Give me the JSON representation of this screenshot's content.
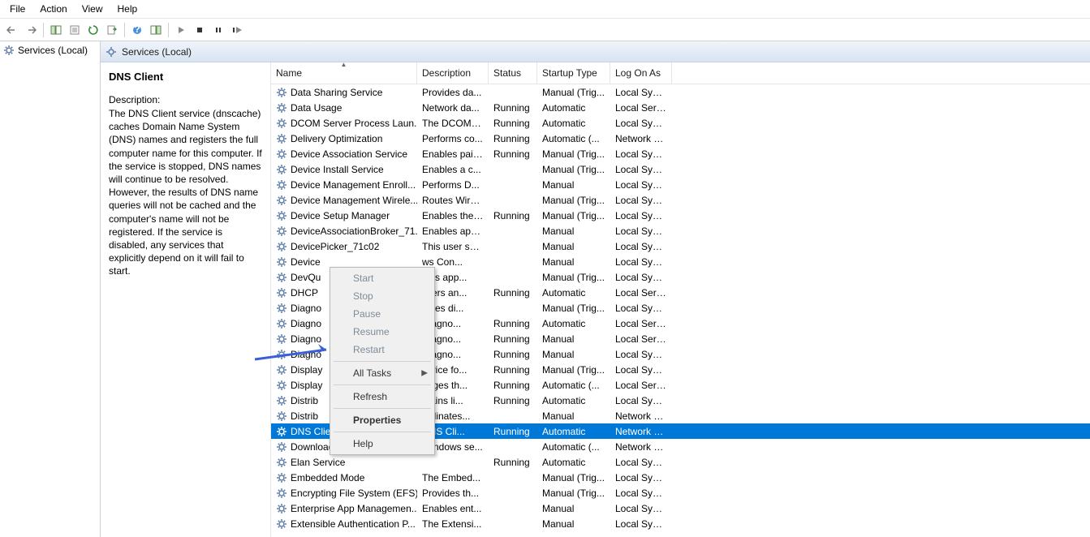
{
  "menu": {
    "items": [
      "File",
      "Action",
      "View",
      "Help"
    ]
  },
  "tree": {
    "root": "Services (Local)"
  },
  "tab": {
    "title": "Services (Local)"
  },
  "detail": {
    "title": "DNS Client",
    "subhead": "Description:",
    "description": "The DNS Client service (dnscache) caches Domain Name System (DNS) names and registers the full computer name for this computer. If the service is stopped, DNS names will continue to be resolved. However, the results of DNS name queries will not be cached and the computer's name will not be registered. If the service is disabled, any services that explicitly depend on it will fail to start."
  },
  "columns": [
    "Name",
    "Description",
    "Status",
    "Startup Type",
    "Log On As"
  ],
  "rows": [
    {
      "name": "Data Sharing Service",
      "desc": "Provides da...",
      "status": "",
      "startup": "Manual (Trig...",
      "logon": "Local Syste..."
    },
    {
      "name": "Data Usage",
      "desc": "Network da...",
      "status": "Running",
      "startup": "Automatic",
      "logon": "Local Service"
    },
    {
      "name": "DCOM Server Process Laun...",
      "desc": "The DCOML...",
      "status": "Running",
      "startup": "Automatic",
      "logon": "Local Syste..."
    },
    {
      "name": "Delivery Optimization",
      "desc": "Performs co...",
      "status": "Running",
      "startup": "Automatic (...",
      "logon": "Network S..."
    },
    {
      "name": "Device Association Service",
      "desc": "Enables pair...",
      "status": "Running",
      "startup": "Manual (Trig...",
      "logon": "Local Syste..."
    },
    {
      "name": "Device Install Service",
      "desc": "Enables a c...",
      "status": "",
      "startup": "Manual (Trig...",
      "logon": "Local Syste..."
    },
    {
      "name": "Device Management Enroll...",
      "desc": "Performs D...",
      "status": "",
      "startup": "Manual",
      "logon": "Local Syste..."
    },
    {
      "name": "Device Management Wirele...",
      "desc": "Routes Wire...",
      "status": "",
      "startup": "Manual (Trig...",
      "logon": "Local Syste..."
    },
    {
      "name": "Device Setup Manager",
      "desc": "Enables the ...",
      "status": "Running",
      "startup": "Manual (Trig...",
      "logon": "Local Syste..."
    },
    {
      "name": "DeviceAssociationBroker_71...",
      "desc": "Enables app...",
      "status": "",
      "startup": "Manual",
      "logon": "Local Syste..."
    },
    {
      "name": "DevicePicker_71c02",
      "desc": "This user ser...",
      "status": "",
      "startup": "Manual",
      "logon": "Local Syste..."
    },
    {
      "name": "Device",
      "desc": "ws Con...",
      "status": "",
      "startup": "Manual",
      "logon": "Local Syste..."
    },
    {
      "name": "DevQu",
      "desc": "bles app...",
      "status": "",
      "startup": "Manual (Trig...",
      "logon": "Local Syste..."
    },
    {
      "name": "DHCP",
      "desc": "isters an...",
      "status": "Running",
      "startup": "Automatic",
      "logon": "Local Service"
    },
    {
      "name": "Diagno",
      "desc": "cutes di...",
      "status": "",
      "startup": "Manual (Trig...",
      "logon": "Local Syste..."
    },
    {
      "name": "Diagno",
      "desc": "Diagno...",
      "status": "Running",
      "startup": "Automatic",
      "logon": "Local Service"
    },
    {
      "name": "Diagno",
      "desc": "Diagno...",
      "status": "Running",
      "startup": "Manual",
      "logon": "Local Service"
    },
    {
      "name": "Diagno",
      "desc": "Diagno...",
      "status": "Running",
      "startup": "Manual",
      "logon": "Local Syste..."
    },
    {
      "name": "Display",
      "desc": "ervice fo...",
      "status": "Running",
      "startup": "Manual (Trig...",
      "logon": "Local Syste..."
    },
    {
      "name": "Display",
      "desc": "nages th...",
      "status": "Running",
      "startup": "Automatic (...",
      "logon": "Local Service"
    },
    {
      "name": "Distrib",
      "desc": "ntains li...",
      "status": "Running",
      "startup": "Automatic",
      "logon": "Local Syste..."
    },
    {
      "name": "Distrib",
      "desc": "ordinates...",
      "status": "",
      "startup": "Manual",
      "logon": "Network S..."
    },
    {
      "name": "DNS Client",
      "desc": "DNS Cli...",
      "status": "Running",
      "startup": "Automatic",
      "logon": "Network S...",
      "selected": true
    },
    {
      "name": "Downloaded Maps Manager",
      "desc": "Windows se...",
      "status": "",
      "startup": "Automatic (...",
      "logon": "Network S..."
    },
    {
      "name": "Elan Service",
      "desc": "",
      "status": "Running",
      "startup": "Automatic",
      "logon": "Local Syste..."
    },
    {
      "name": "Embedded Mode",
      "desc": "The Embed...",
      "status": "",
      "startup": "Manual (Trig...",
      "logon": "Local Syste..."
    },
    {
      "name": "Encrypting File System (EFS)",
      "desc": "Provides th...",
      "status": "",
      "startup": "Manual (Trig...",
      "logon": "Local Syste..."
    },
    {
      "name": "Enterprise App Managemen...",
      "desc": "Enables ent...",
      "status": "",
      "startup": "Manual",
      "logon": "Local Syste..."
    },
    {
      "name": "Extensible Authentication P...",
      "desc": "The Extensi...",
      "status": "",
      "startup": "Manual",
      "logon": "Local Syste..."
    }
  ],
  "context_menu": {
    "items": [
      {
        "label": "Start",
        "disabled": true
      },
      {
        "label": "Stop",
        "disabled": true
      },
      {
        "label": "Pause",
        "disabled": true
      },
      {
        "label": "Resume",
        "disabled": true
      },
      {
        "label": "Restart",
        "disabled": true
      },
      {
        "sep": true
      },
      {
        "label": "All Tasks",
        "submenu": true
      },
      {
        "sep": true
      },
      {
        "label": "Refresh"
      },
      {
        "sep": true
      },
      {
        "label": "Properties",
        "bold": true
      },
      {
        "sep": true
      },
      {
        "label": "Help"
      }
    ]
  }
}
